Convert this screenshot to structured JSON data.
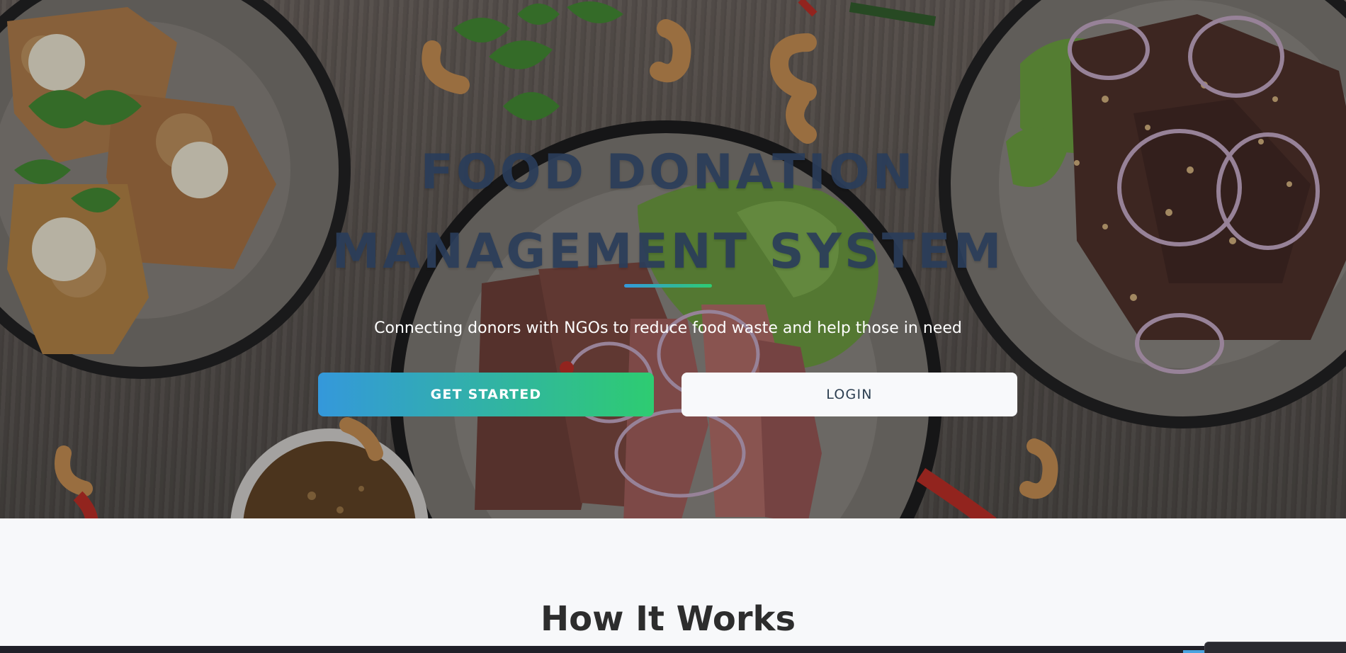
{
  "hero": {
    "title_line1": "FOOD DONATION",
    "title_line2": "MANAGEMENT SYSTEM",
    "subtitle": "Connecting donors with NGOs to reduce food waste and help those in need",
    "get_started_label": "GET STARTED",
    "login_label": "LOGIN"
  },
  "section": {
    "title": "How It Works"
  },
  "colors": {
    "accent_blue": "#3498db",
    "accent_green": "#2ecc71",
    "title_color": "#2a3d5a",
    "page_bg": "#f7f8fa"
  }
}
